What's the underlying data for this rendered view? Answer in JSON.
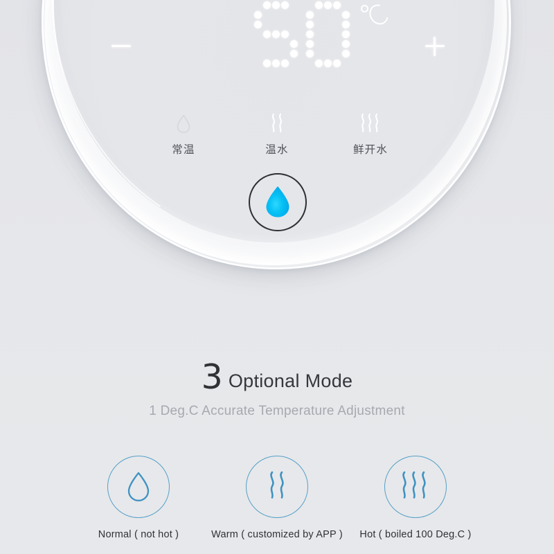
{
  "product_panel": {
    "display": {
      "value": "50",
      "unit": "°C",
      "digits": [
        "5",
        "0"
      ]
    },
    "decrease_button": {
      "icon": "minus-icon",
      "label": "−"
    },
    "increase_button": {
      "icon": "plus-icon",
      "label": "+"
    },
    "modes": [
      {
        "label": "常温",
        "icon": "water-drop-icon",
        "steam_lines": 0
      },
      {
        "label": "温水",
        "icon": "steam-2-icon",
        "steam_lines": 2
      },
      {
        "label": "鲜开水",
        "icon": "steam-3-icon",
        "steam_lines": 3
      }
    ],
    "dispense_button": {
      "icon": "water-drop-filled-icon",
      "accent_color": "#00bdf2"
    }
  },
  "headline": {
    "number": "3",
    "text": "Optional Mode"
  },
  "subheadline": "1 Deg.C Accurate Temperature Adjustment",
  "features": [
    {
      "icon": "water-drop-outline-icon",
      "caption": "Normal ( not hot )",
      "steam_lines": 0
    },
    {
      "icon": "steam-2-outline-icon",
      "caption": "Warm ( customized by APP )",
      "steam_lines": 2
    },
    {
      "icon": "steam-3-outline-icon",
      "caption": "Hot ( boiled 100 Deg.C )",
      "steam_lines": 3
    }
  ],
  "colors": {
    "background": "#e6e7ea",
    "accent_blue": "#55a0c8",
    "droplet_cyan": "#00bdf2",
    "text_dark": "#2f3135",
    "text_muted": "#a6a9b0"
  }
}
